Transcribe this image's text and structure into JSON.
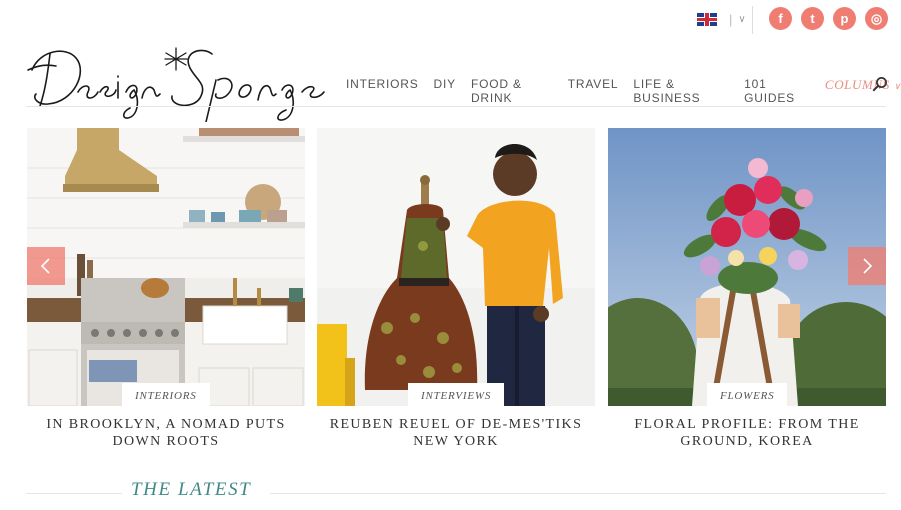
{
  "header": {
    "brand": "Design*Sponge",
    "language_icon": "uk-flag-icon",
    "social": [
      {
        "name": "facebook-icon",
        "glyph": "f"
      },
      {
        "name": "twitter-icon",
        "glyph": "t"
      },
      {
        "name": "pinterest-icon",
        "glyph": "p"
      },
      {
        "name": "instagram-icon",
        "glyph": "◎"
      }
    ],
    "nav": {
      "items": [
        "INTERIORS",
        "DIY",
        "FOOD & DRINK",
        "TRAVEL",
        "LIFE & BUSINESS",
        "101 GUIDES"
      ],
      "columns": "COLUMNS"
    }
  },
  "carousel": {
    "slides": [
      {
        "tag": "INTERIORS",
        "title": "IN BROOKLYN, A NOMAD PUTS DOWN ROOTS"
      },
      {
        "tag": "INTERVIEWS",
        "title": "REUBEN REUEL OF DE-MES'TIKS NEW YORK"
      },
      {
        "tag": "FLOWERS",
        "title": "FLORAL PROFILE: FROM THE GROUND, KOREA"
      }
    ]
  },
  "latest": {
    "heading": "THE LATEST"
  },
  "colors": {
    "accent": "#ef7d72",
    "teal": "#3f8a86"
  }
}
